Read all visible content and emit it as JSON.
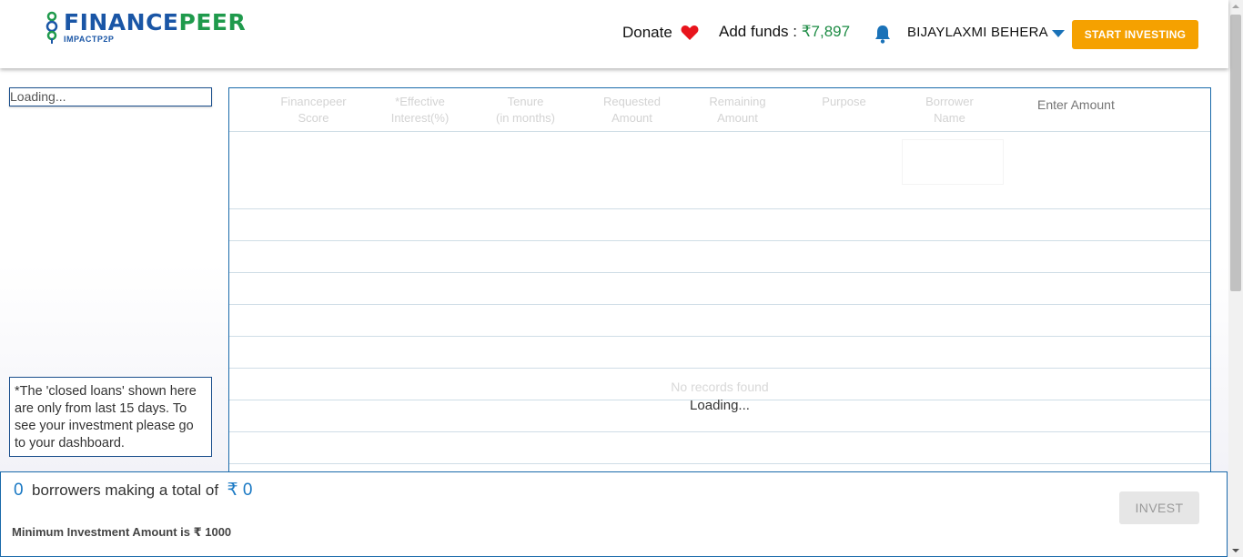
{
  "brand": {
    "name_part1": "FINANCE",
    "name_part2": "PEER",
    "tagline": "IMPACTP2P"
  },
  "header": {
    "donate_label": "Donate",
    "funds_label": "Add funds : ",
    "funds_amount": "₹7,897",
    "user_name": "BIJAYLAXMI BEHERA",
    "start_button": "START INVESTING"
  },
  "sidebar": {
    "loading_text": "Loading...",
    "note": "*The 'closed loans' shown here are only from last 15 days. To see your investment please go to your dashboard."
  },
  "table": {
    "columns": [
      {
        "line1": "Financepeer",
        "line2": "Score"
      },
      {
        "line1": "*Effective",
        "line2": "Interest(%)"
      },
      {
        "line1": "Tenure",
        "line2": "(in months)"
      },
      {
        "line1": "Requested",
        "line2": "Amount"
      },
      {
        "line1": "Remaining",
        "line2": "Amount"
      },
      {
        "line1": "Purpose",
        "line2": ""
      },
      {
        "line1": "Borrower",
        "line2": "Name"
      }
    ],
    "amount_placeholder": "Enter Amount",
    "no_records": "No records found",
    "loading": "Loading..."
  },
  "footer": {
    "borrower_count": "0",
    "summary_text": "borrowers making a total of",
    "total_amount": "₹ 0",
    "min_investment": "Minimum Investment Amount is ₹ 1000",
    "invest_button": "INVEST"
  },
  "colors": {
    "primary_blue": "#1a56a6",
    "brand_green": "#1f9a4c",
    "accent_orange": "#f5a100",
    "heart_red": "#e8141c",
    "bell_blue": "#1a72b8"
  },
  "icons": [
    "logo-mark-icon",
    "heart-icon",
    "bell-icon",
    "caret-down-icon"
  ]
}
